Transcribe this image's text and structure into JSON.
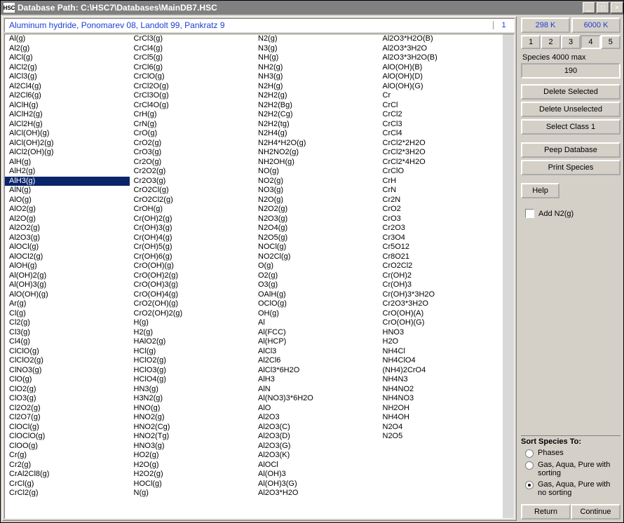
{
  "window": {
    "icon": "HSC",
    "title": "Database Path: C:\\HSC7\\Databases\\MainDB7.HSC"
  },
  "infobar": {
    "desc": "Aluminum hydride, Ponomarev 08, Landolt 99, Pankratz 9",
    "count": "1"
  },
  "columns": [
    [
      "Al(g)",
      "Al2(g)",
      "AlCl(g)",
      "AlCl2(g)",
      "AlCl3(g)",
      "Al2Cl4(g)",
      "Al2Cl6(g)",
      "AlClH(g)",
      "AlClH2(g)",
      "AlCl2H(g)",
      "AlCl(OH)(g)",
      "AlCl(OH)2(g)",
      "AlCl2(OH)(g)",
      "AlH(g)",
      "AlH2(g)",
      "AlH3(g)",
      "AlN(g)",
      "AlO(g)",
      "AlO2(g)",
      "Al2O(g)",
      "Al2O2(g)",
      "Al2O3(g)",
      "AlOCl(g)",
      "AlOCl2(g)",
      "AlOH(g)",
      "Al(OH)2(g)",
      "Al(OH)3(g)",
      "AlO(OH)(g)",
      "Ar(g)",
      "Cl(g)",
      "Cl2(g)",
      "Cl3(g)",
      "Cl4(g)",
      "ClClO(g)",
      "ClClO2(g)",
      "ClNO3(g)",
      "ClO(g)",
      "ClO2(g)",
      "ClO3(g)",
      "Cl2O2(g)",
      "Cl2O7(g)",
      "ClOCl(g)",
      "ClOClO(g)",
      "ClOO(g)",
      "Cr(g)",
      "Cr2(g)",
      "CrAl2Cl8(g)",
      "CrCl(g)",
      "CrCl2(g)"
    ],
    [
      "CrCl3(g)",
      "CrCl4(g)",
      "CrCl5(g)",
      "CrCl6(g)",
      "CrClO(g)",
      "CrCl2O(g)",
      "CrCl3O(g)",
      "CrCl4O(g)",
      "CrH(g)",
      "CrN(g)",
      "CrO(g)",
      "CrO2(g)",
      "CrO3(g)",
      "Cr2O(g)",
      "Cr2O2(g)",
      "Cr2O3(g)",
      "CrO2Cl(g)",
      "CrO2Cl2(g)",
      "CrOH(g)",
      "Cr(OH)2(g)",
      "Cr(OH)3(g)",
      "Cr(OH)4(g)",
      "Cr(OH)5(g)",
      "Cr(OH)6(g)",
      "CrO(OH)(g)",
      "CrO(OH)2(g)",
      "CrO(OH)3(g)",
      "CrO(OH)4(g)",
      "CrO2(OH)(g)",
      "CrO2(OH)2(g)",
      "H(g)",
      "H2(g)",
      "HAlO2(g)",
      "HCl(g)",
      "HClO2(g)",
      "HClO3(g)",
      "HClO4(g)",
      "HN3(g)",
      "H3N2(g)",
      "HNO(g)",
      "HNO2(g)",
      "HNO2(Cg)",
      "HNO2(Tg)",
      "HNO3(g)",
      "HO2(g)",
      "H2O(g)",
      "H2O2(g)",
      "HOCl(g)",
      "N(g)"
    ],
    [
      "N2(g)",
      "N3(g)",
      "NH(g)",
      "NH2(g)",
      "NH3(g)",
      "N2H(g)",
      "N2H2(g)",
      "N2H2(Bg)",
      "N2H2(Cg)",
      "N2H2(tg)",
      "N2H4(g)",
      "N2H4*H2O(g)",
      "NH2NO2(g)",
      "NH2OH(g)",
      "NO(g)",
      "NO2(g)",
      "NO3(g)",
      "N2O(g)",
      "N2O2(g)",
      "N2O3(g)",
      "N2O4(g)",
      "N2O5(g)",
      "NOCl(g)",
      "NO2Cl(g)",
      "O(g)",
      "O2(g)",
      "O3(g)",
      "OAlH(g)",
      "OClO(g)",
      "OH(g)",
      "Al",
      "Al(FCC)",
      "Al(HCP)",
      "AlCl3",
      "Al2Cl6",
      "AlCl3*6H2O",
      "AlH3",
      "AlN",
      "Al(NO3)3*6H2O",
      "AlO",
      "Al2O3",
      "Al2O3(C)",
      "Al2O3(D)",
      "Al2O3(G)",
      "Al2O3(K)",
      "AlOCl",
      "Al(OH)3",
      "Al(OH)3(G)",
      "Al2O3*H2O"
    ],
    [
      "Al2O3*H2O(B)",
      "Al2O3*3H2O",
      "Al2O3*3H2O(B)",
      "AlO(OH)(B)",
      "AlO(OH)(D)",
      "AlO(OH)(G)",
      "Cr",
      "CrCl",
      "CrCl2",
      "CrCl3",
      "CrCl4",
      "CrCl2*2H2O",
      "CrCl2*3H2O",
      "CrCl2*4H2O",
      "CrClO",
      "CrH",
      "CrN",
      "Cr2N",
      "CrO2",
      "CrO3",
      "Cr2O3",
      "Cr3O4",
      "Cr5O12",
      "Cr8O21",
      "CrO2Cl2",
      "Cr(OH)2",
      "Cr(OH)3",
      "Cr(OH)3*3H2O",
      "Cr2O3*3H2O",
      "CrO(OH)(A)",
      "CrO(OH)(G)",
      "HNO3",
      "H2O",
      "NH4Cl",
      "NH4ClO4",
      "(NH4)2CrO4",
      "NH4N3",
      "NH4NO2",
      "NH4NO3",
      "NH2OH",
      "NH4OH",
      "N2O4",
      "N2O5"
    ]
  ],
  "selected": {
    "col": 0,
    "row": 15
  },
  "right": {
    "temps": [
      "298 K",
      "6000 K"
    ],
    "tabs": [
      "1",
      "2",
      "3",
      "4",
      "5"
    ],
    "tab_active": 3,
    "species_label": "Species 4000 max",
    "species_count": "190",
    "btn_delete_selected": "Delete Selected",
    "btn_delete_unselected": "Delete Unselected",
    "btn_select_class": "Select Class 1",
    "btn_peep": "Peep Database",
    "btn_print": "Print Species",
    "btn_help": "Help",
    "add_label": "Add N2(g)",
    "sort_label": "Sort Species To:",
    "sort_options": [
      "Phases",
      "Gas, Aqua, Pure with sorting",
      "Gas, Aqua, Pure with no sorting"
    ],
    "sort_selected": 2,
    "btn_return": "Return",
    "btn_continue": "Continue"
  }
}
